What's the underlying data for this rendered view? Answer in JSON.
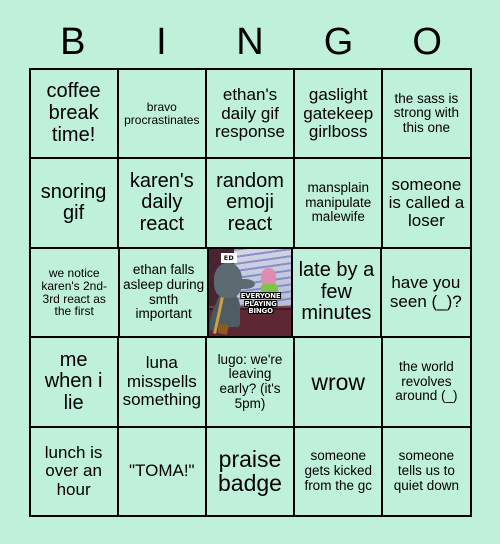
{
  "background_color": "#bff0da",
  "border_color": "#000000",
  "text_color": "#000000",
  "header": {
    "letters": [
      "B",
      "I",
      "N",
      "G",
      "O"
    ]
  },
  "grid": {
    "rows": 5,
    "columns": 5,
    "cells": [
      [
        {
          "text": "coffee break time!",
          "size": "lg",
          "type": "text"
        },
        {
          "text": "bravo procrastinates",
          "size": "xs",
          "type": "text"
        },
        {
          "text": "ethan's daily gif response",
          "size": "md",
          "type": "text"
        },
        {
          "text": "gaslight gatekeep girlboss",
          "size": "md",
          "type": "text"
        },
        {
          "text": "the sass is strong with this one",
          "size": "sm",
          "type": "text"
        }
      ],
      [
        {
          "text": "snoring gif",
          "size": "lg",
          "type": "text"
        },
        {
          "text": "karen's daily react",
          "size": "lg",
          "type": "text"
        },
        {
          "text": "random emoji react",
          "size": "lg",
          "type": "text"
        },
        {
          "text": "mansplain manipulate malewife",
          "size": "sm",
          "type": "text"
        },
        {
          "text": "someone is called a loser",
          "size": "md",
          "type": "text"
        }
      ],
      [
        {
          "text": "we notice karen's 2nd-3rd react as the first",
          "size": "xs",
          "type": "text"
        },
        {
          "text": "ethan falls asleep during smth important",
          "size": "sm",
          "type": "text"
        },
        {
          "type": "image",
          "image": {
            "name": "spongebob-squidward-window-meme",
            "caption": "EVERYONE PLAYING BINGO",
            "badge": "ED"
          }
        },
        {
          "text": "late by a few minutes",
          "size": "lg",
          "type": "text"
        },
        {
          "text": "have you seen (_)?",
          "size": "md",
          "type": "text"
        }
      ],
      [
        {
          "text": "me when i lie",
          "size": "lg",
          "type": "text"
        },
        {
          "text": "luna misspells something",
          "size": "md",
          "type": "text"
        },
        {
          "text": "lugo: we're leaving early? (it's 5pm)",
          "size": "sm",
          "type": "text"
        },
        {
          "text": "wrow",
          "size": "xl",
          "type": "text"
        },
        {
          "text": "the world revolves around (_)",
          "size": "sm",
          "type": "text"
        }
      ],
      [
        {
          "text": "lunch is over an hour",
          "size": "md",
          "type": "text"
        },
        {
          "text": "\"TOMA!\"",
          "size": "md",
          "type": "text"
        },
        {
          "text": "praise badge",
          "size": "xl",
          "type": "text"
        },
        {
          "text": "someone gets kicked from the gc",
          "size": "sm",
          "type": "text"
        },
        {
          "text": "someone tells us to quiet down",
          "size": "sm",
          "type": "text"
        }
      ]
    ]
  }
}
